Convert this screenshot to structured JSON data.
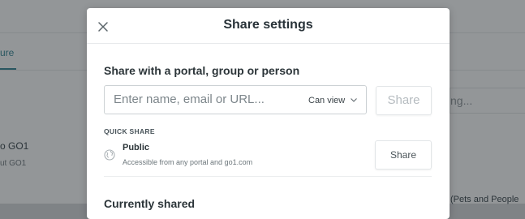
{
  "background": {
    "tab_label": "ure",
    "item_title": "o GO1",
    "item_subtitle": "ut GO1",
    "search_placeholder": "ng...",
    "right_link": "(Pets and People"
  },
  "modal": {
    "title": "Share settings",
    "close_icon": "close-icon",
    "share_section_label": "Share with a portal, group or person",
    "input_placeholder": "Enter name, email or URL...",
    "permission_value": "Can view",
    "share_button_label": "Share",
    "quick_share_label": "QUICK SHARE",
    "public": {
      "title": "Public",
      "description": "Accessible from any portal and go1.com",
      "icon": "globe-icon",
      "share_button_label": "Share"
    },
    "currently_shared_label": "Currently shared"
  },
  "colors": {
    "accent": "#2a7f8f",
    "overlay": "#282e32"
  }
}
